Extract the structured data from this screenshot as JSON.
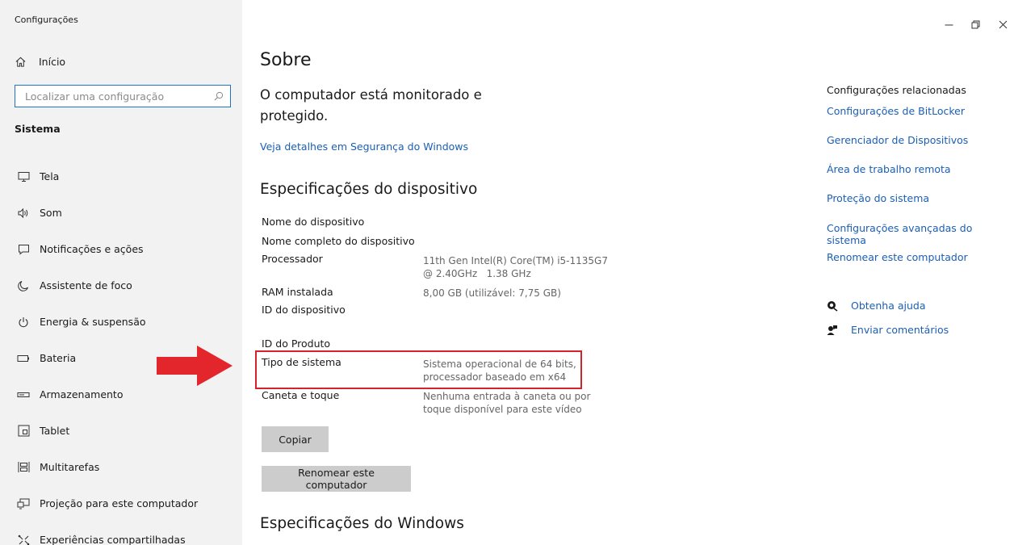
{
  "window": {
    "title": "Configurações"
  },
  "sidebar": {
    "home_label": "Início",
    "search_placeholder": "Localizar uma configuração",
    "section_label": "Sistema",
    "items": [
      {
        "label": "Tela",
        "icon": "monitor-icon"
      },
      {
        "label": "Som",
        "icon": "speaker-icon"
      },
      {
        "label": "Notificações e ações",
        "icon": "notification-icon"
      },
      {
        "label": "Assistente de foco",
        "icon": "moon-icon"
      },
      {
        "label": "Energia & suspensão",
        "icon": "power-icon"
      },
      {
        "label": "Bateria",
        "icon": "battery-icon"
      },
      {
        "label": "Armazenamento",
        "icon": "storage-icon"
      },
      {
        "label": "Tablet",
        "icon": "tablet-icon"
      },
      {
        "label": "Multitarefas",
        "icon": "multitask-icon"
      },
      {
        "label": "Projeção para este computador",
        "icon": "projection-icon"
      },
      {
        "label": "Experiências compartilhadas",
        "icon": "shared-icon"
      }
    ]
  },
  "main": {
    "title": "Sobre",
    "security_status": "O computador está monitorado e protegido.",
    "security_link": "Veja detalhes em Segurança do Windows",
    "device_specs_heading": "Especificações do dispositivo",
    "specs": {
      "device_name_label": "Nome do dispositivo",
      "full_device_name_label": "Nome completo do dispositivo",
      "processor_label": "Processador",
      "processor_line1": "11th Gen Intel(R) Core(TM) i5-1135G7",
      "processor_line2": "@ 2.40GHz   1.38 GHz",
      "ram_label": "RAM instalada",
      "ram_value": "8,00 GB (utilizável: 7,75 GB)",
      "device_id_label": "ID do dispositivo",
      "product_id_label": "ID do Produto",
      "system_type_label": "Tipo de sistema",
      "system_type_line1": "Sistema operacional de 64 bits,",
      "system_type_line2": "processador baseado em x64",
      "pen_touch_label": "Caneta e toque",
      "pen_touch_line1": "Nenhuma entrada à caneta ou por",
      "pen_touch_line2": "toque disponível para este vídeo"
    },
    "copy_button": "Copiar",
    "rename_button": "Renomear este computador",
    "windows_specs_heading": "Especificações do Windows"
  },
  "related": {
    "title": "Configurações relacionadas",
    "links": [
      "Configurações de BitLocker",
      "Gerenciador de Dispositivos",
      "Área de trabalho remota",
      "Proteção do sistema",
      "Configurações avançadas do sistema",
      "Renomear este computador"
    ],
    "help_label": "Obtenha ajuda",
    "feedback_label": "Enviar comentários"
  },
  "colors": {
    "link": "#1a5fb4",
    "highlight": "#d4232b",
    "sidebar_bg": "#f2f2f2",
    "button_bg": "#cccccc"
  }
}
